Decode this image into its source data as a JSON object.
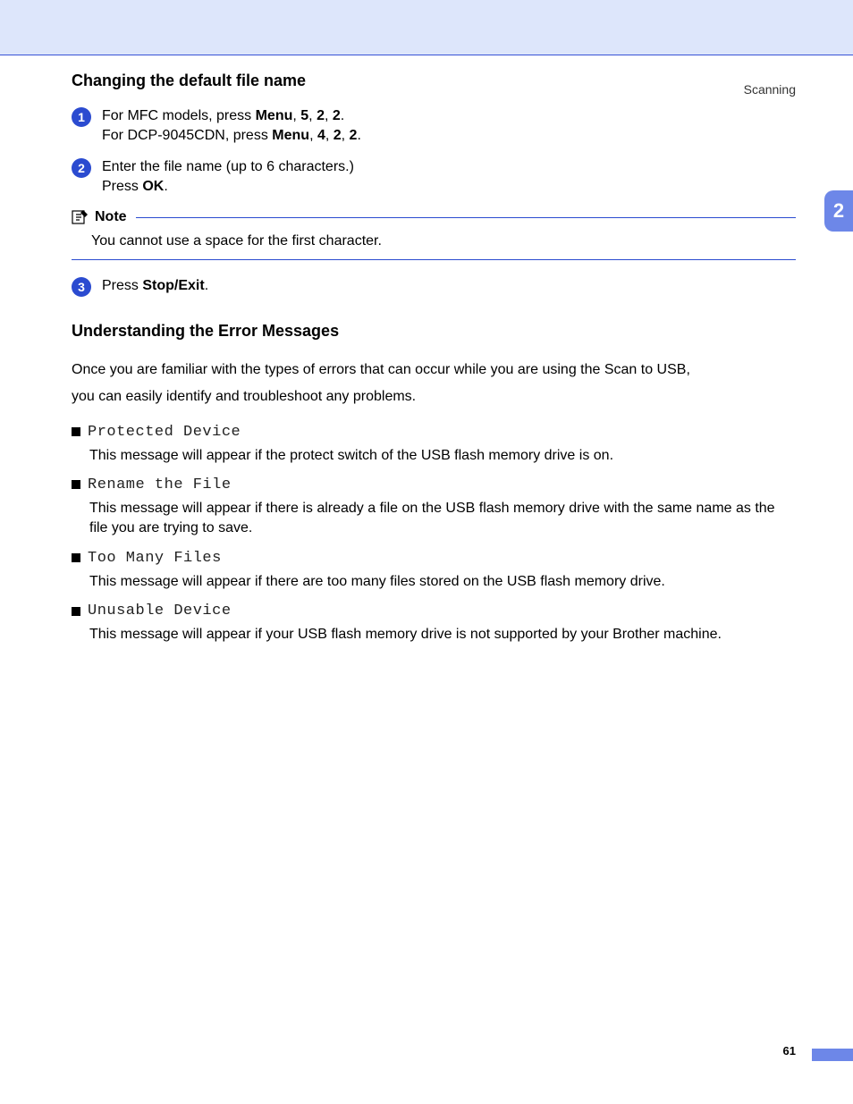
{
  "header": {
    "section": "Scanning",
    "chapter_number": "2"
  },
  "footer": {
    "page_number": "61"
  },
  "section1": {
    "title": "Changing the default file name",
    "steps": {
      "s1": {
        "num": "1",
        "line1_pre": "For MFC models, press ",
        "line1_b1": "Menu",
        "line1_c1": ", ",
        "line1_b2": "5",
        "line1_c2": ", ",
        "line1_b3": "2",
        "line1_c3": ", ",
        "line1_b4": "2",
        "line1_c4": ".",
        "line2_pre": "For DCP-9045CDN, press ",
        "line2_b1": "Menu",
        "line2_c1": ", ",
        "line2_b2": "4",
        "line2_c2": ", ",
        "line2_b3": "2",
        "line2_c3": ", ",
        "line2_b4": "2",
        "line2_c4": "."
      },
      "s2": {
        "num": "2",
        "line1": "Enter the file name (up to 6 characters.)",
        "line2_pre": "Press ",
        "line2_b1": "OK",
        "line2_post": "."
      },
      "s3": {
        "num": "3",
        "line1_pre": "Press ",
        "line1_b1": "Stop/Exit",
        "line1_post": "."
      }
    },
    "note": {
      "label": "Note",
      "body": "You cannot use a space for the first character."
    }
  },
  "section2": {
    "title": "Understanding the Error Messages",
    "intro_l1": "Once you are familiar with the types of errors that can occur while you are using the Scan to USB,",
    "intro_l2": "you can easily identify and troubleshoot any problems.",
    "errors": [
      {
        "title": "Protected Device",
        "desc": "This message will appear if the protect switch of the USB flash memory drive is on."
      },
      {
        "title": "Rename the File",
        "desc": "This message will appear if there is already a file on the USB flash memory drive with the same name as the file you are trying to save."
      },
      {
        "title": "Too Many Files",
        "desc": "This message will appear if there are too many files stored on the USB flash memory drive."
      },
      {
        "title": "Unusable Device",
        "desc": "This message will appear if your USB flash memory drive is not supported by your Brother machine."
      }
    ]
  }
}
